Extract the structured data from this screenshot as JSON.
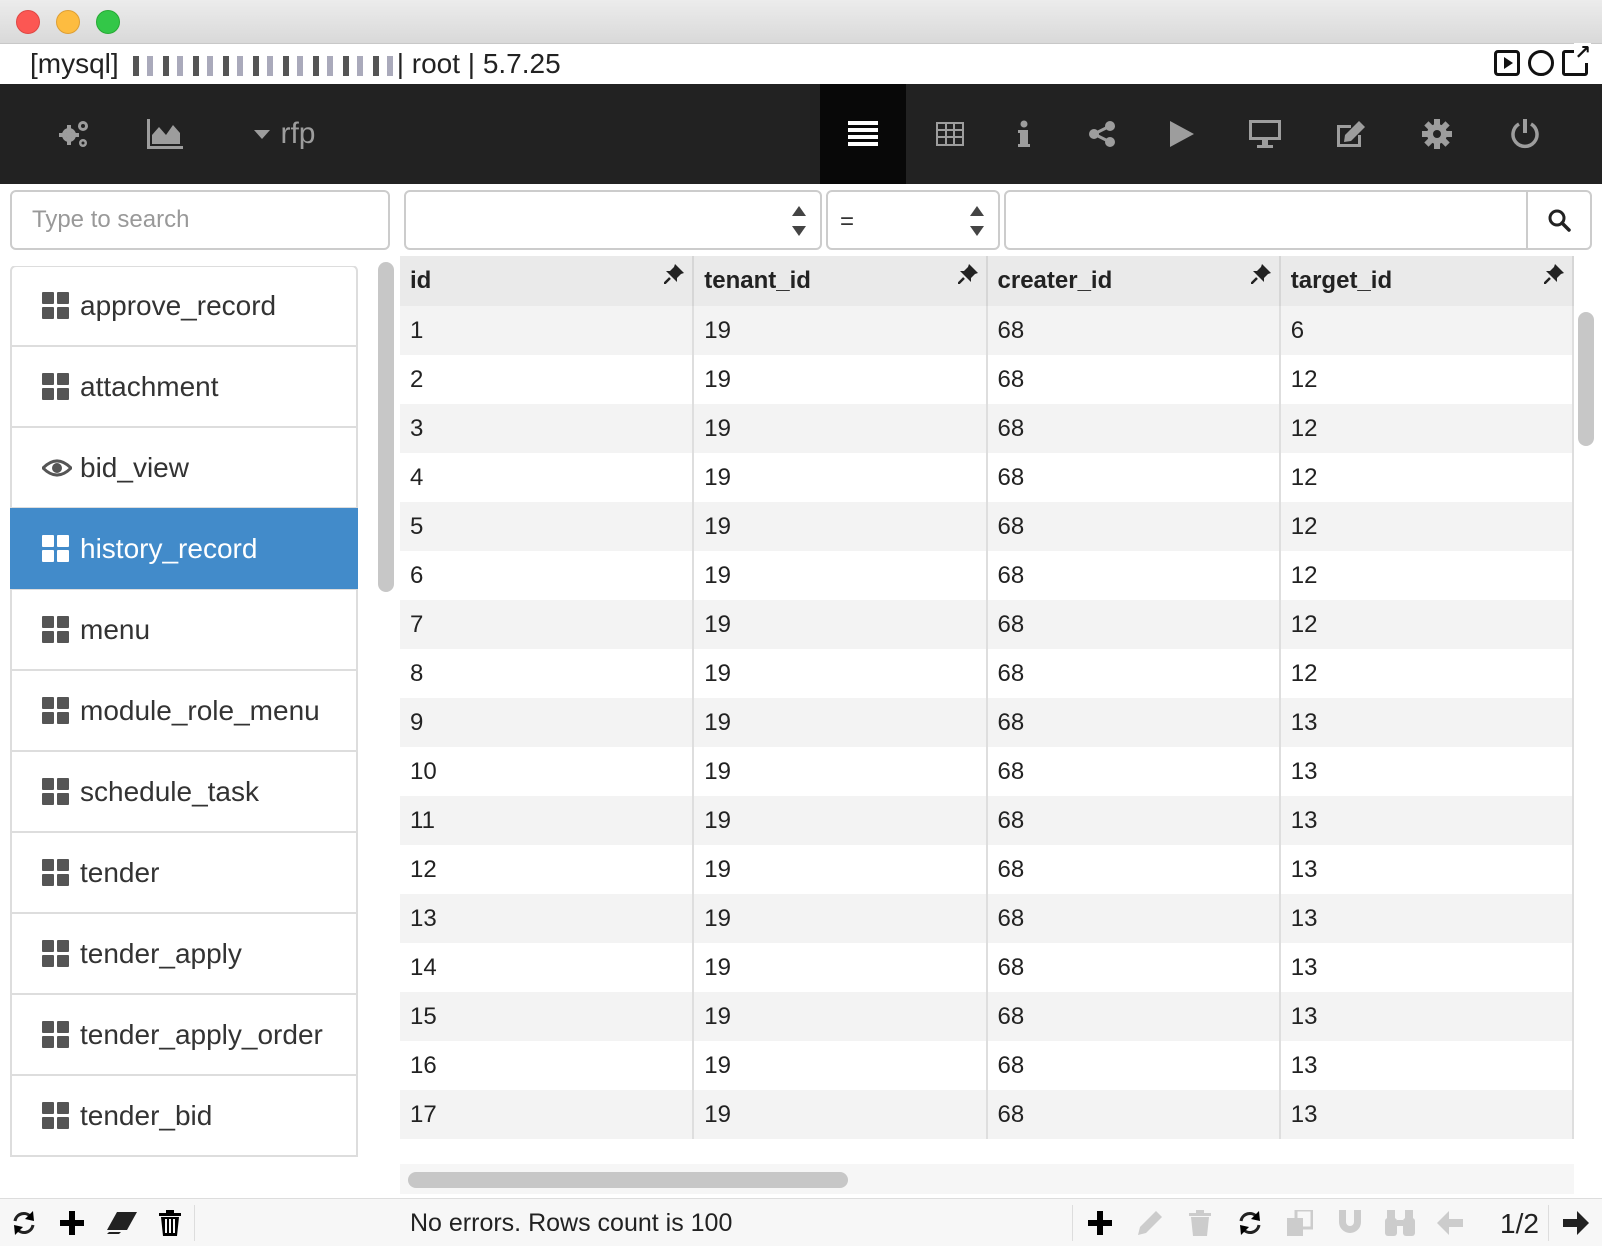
{
  "window": {
    "connection_prefix": "[mysql]",
    "connection_suffix": "| root | 5.7.25"
  },
  "toolbar": {
    "database": "rfp",
    "icons_left": [
      "cogs-icon",
      "area-chart-icon"
    ],
    "icons_right": [
      "list-icon",
      "table-icon",
      "info-icon",
      "share-icon",
      "play-icon",
      "desktop-icon",
      "edit-icon",
      "gear-icon",
      "power-icon"
    ],
    "active": "list-icon"
  },
  "sidebar": {
    "search_placeholder": "Type to search",
    "items": [
      {
        "label": "approve_record",
        "icon": "table-icon",
        "active": false
      },
      {
        "label": "attachment",
        "icon": "table-icon",
        "active": false
      },
      {
        "label": "bid_view",
        "icon": "eye-icon",
        "active": false
      },
      {
        "label": "history_record",
        "icon": "table-icon",
        "active": true
      },
      {
        "label": "menu",
        "icon": "table-icon",
        "active": false
      },
      {
        "label": "module_role_menu",
        "icon": "table-icon",
        "active": false
      },
      {
        "label": "schedule_task",
        "icon": "table-icon",
        "active": false
      },
      {
        "label": "tender",
        "icon": "table-icon",
        "active": false
      },
      {
        "label": "tender_apply",
        "icon": "table-icon",
        "active": false
      },
      {
        "label": "tender_apply_order",
        "icon": "table-icon",
        "active": false
      },
      {
        "label": "tender_bid",
        "icon": "table-icon",
        "active": false
      }
    ]
  },
  "filter": {
    "column_value": "",
    "operator": "=",
    "value": ""
  },
  "grid": {
    "columns": [
      "id",
      "tenant_id",
      "creater_id",
      "target_id"
    ],
    "rows": [
      [
        "1",
        "19",
        "68",
        "6"
      ],
      [
        "2",
        "19",
        "68",
        "12"
      ],
      [
        "3",
        "19",
        "68",
        "12"
      ],
      [
        "4",
        "19",
        "68",
        "12"
      ],
      [
        "5",
        "19",
        "68",
        "12"
      ],
      [
        "6",
        "19",
        "68",
        "12"
      ],
      [
        "7",
        "19",
        "68",
        "12"
      ],
      [
        "8",
        "19",
        "68",
        "12"
      ],
      [
        "9",
        "19",
        "68",
        "13"
      ],
      [
        "10",
        "19",
        "68",
        "13"
      ],
      [
        "11",
        "19",
        "68",
        "13"
      ],
      [
        "12",
        "19",
        "68",
        "13"
      ],
      [
        "13",
        "19",
        "68",
        "13"
      ],
      [
        "14",
        "19",
        "68",
        "13"
      ],
      [
        "15",
        "19",
        "68",
        "13"
      ],
      [
        "16",
        "19",
        "68",
        "13"
      ],
      [
        "17",
        "19",
        "68",
        "13"
      ]
    ]
  },
  "status": {
    "text": "No errors. Rows count is 100",
    "page": "1/2"
  }
}
